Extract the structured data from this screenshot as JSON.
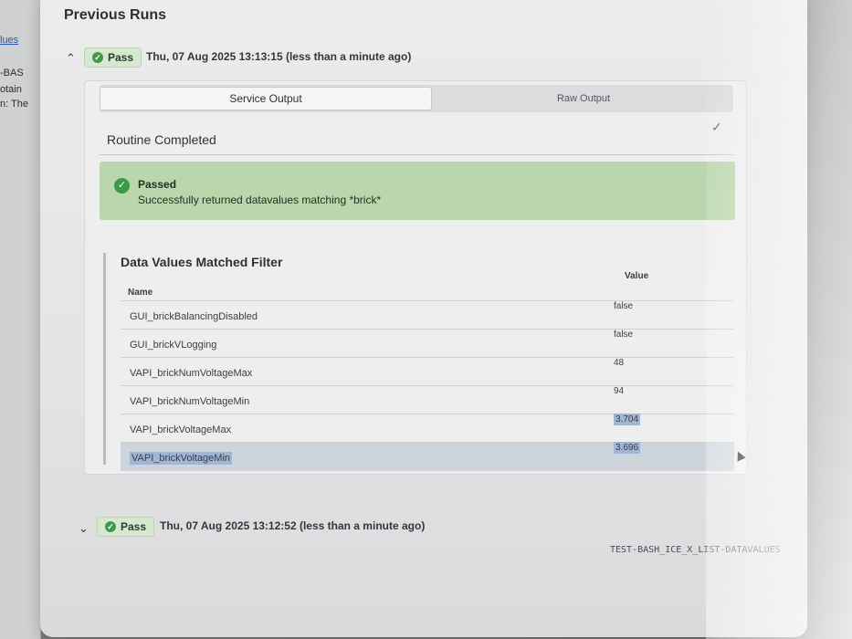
{
  "background_window": {
    "lines": [
      "lues",
      "-BAS",
      "otain",
      "n: The"
    ]
  },
  "section_title": "Previous Runs",
  "runs": [
    {
      "expanded": true,
      "status": "Pass",
      "timestamp": "Thu, 07 Aug 2025 13:13:15 (less than a minute ago)"
    },
    {
      "expanded": false,
      "status": "Pass",
      "timestamp": "Thu, 07 Aug 2025 13:12:52 (less than a minute ago)"
    }
  ],
  "tabs": {
    "service_output": "Service Output",
    "raw_output": "Raw Output"
  },
  "routine_status": "Routine Completed",
  "alert": {
    "title": "Passed",
    "message": "Successfully returned datavalues matching *brick*"
  },
  "table": {
    "title": "Data Values Matched Filter",
    "col_name": "Name",
    "col_value": "Value",
    "rows": [
      {
        "name": "GUI_brickBalancingDisabled",
        "value": "false"
      },
      {
        "name": "GUI_brickVLogging",
        "value": "false"
      },
      {
        "name": "VAPI_brickNumVoltageMax",
        "value": "48"
      },
      {
        "name": "VAPI_brickNumVoltageMin",
        "value": "94"
      },
      {
        "name": "VAPI_brickVoltageMax",
        "value": "3.704"
      },
      {
        "name": "VAPI_brickVoltageMin",
        "value": "3.696"
      }
    ]
  },
  "footer_code": "TEST-BASH_ICE_X_LIST-DATAVALUES",
  "colors": {
    "pass_green": "#3f9a4c",
    "alert_bg": "#b9d6ad",
    "selection": "#9fb6d4"
  }
}
